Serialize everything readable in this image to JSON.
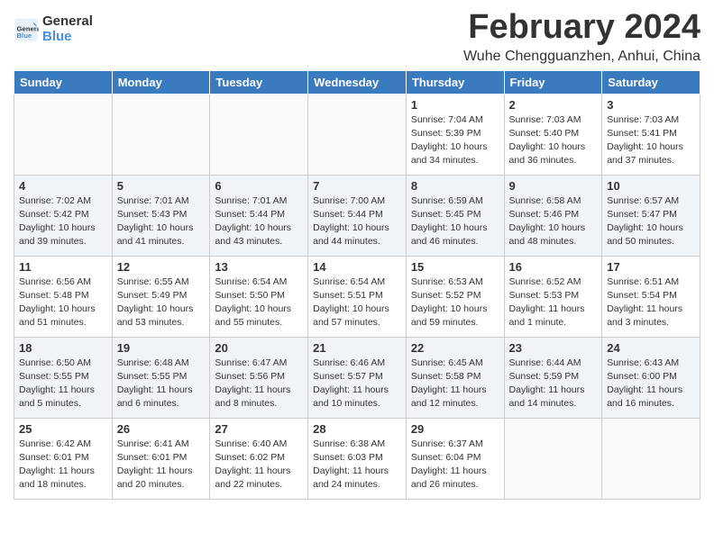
{
  "header": {
    "logo_line1": "General",
    "logo_line2": "Blue",
    "month_year": "February 2024",
    "location": "Wuhe Chengguanzhen, Anhui, China"
  },
  "weekdays": [
    "Sunday",
    "Monday",
    "Tuesday",
    "Wednesday",
    "Thursday",
    "Friday",
    "Saturday"
  ],
  "weeks": [
    [
      {
        "day": "",
        "info": ""
      },
      {
        "day": "",
        "info": ""
      },
      {
        "day": "",
        "info": ""
      },
      {
        "day": "",
        "info": ""
      },
      {
        "day": "1",
        "info": "Sunrise: 7:04 AM\nSunset: 5:39 PM\nDaylight: 10 hours\nand 34 minutes."
      },
      {
        "day": "2",
        "info": "Sunrise: 7:03 AM\nSunset: 5:40 PM\nDaylight: 10 hours\nand 36 minutes."
      },
      {
        "day": "3",
        "info": "Sunrise: 7:03 AM\nSunset: 5:41 PM\nDaylight: 10 hours\nand 37 minutes."
      }
    ],
    [
      {
        "day": "4",
        "info": "Sunrise: 7:02 AM\nSunset: 5:42 PM\nDaylight: 10 hours\nand 39 minutes."
      },
      {
        "day": "5",
        "info": "Sunrise: 7:01 AM\nSunset: 5:43 PM\nDaylight: 10 hours\nand 41 minutes."
      },
      {
        "day": "6",
        "info": "Sunrise: 7:01 AM\nSunset: 5:44 PM\nDaylight: 10 hours\nand 43 minutes."
      },
      {
        "day": "7",
        "info": "Sunrise: 7:00 AM\nSunset: 5:44 PM\nDaylight: 10 hours\nand 44 minutes."
      },
      {
        "day": "8",
        "info": "Sunrise: 6:59 AM\nSunset: 5:45 PM\nDaylight: 10 hours\nand 46 minutes."
      },
      {
        "day": "9",
        "info": "Sunrise: 6:58 AM\nSunset: 5:46 PM\nDaylight: 10 hours\nand 48 minutes."
      },
      {
        "day": "10",
        "info": "Sunrise: 6:57 AM\nSunset: 5:47 PM\nDaylight: 10 hours\nand 50 minutes."
      }
    ],
    [
      {
        "day": "11",
        "info": "Sunrise: 6:56 AM\nSunset: 5:48 PM\nDaylight: 10 hours\nand 51 minutes."
      },
      {
        "day": "12",
        "info": "Sunrise: 6:55 AM\nSunset: 5:49 PM\nDaylight: 10 hours\nand 53 minutes."
      },
      {
        "day": "13",
        "info": "Sunrise: 6:54 AM\nSunset: 5:50 PM\nDaylight: 10 hours\nand 55 minutes."
      },
      {
        "day": "14",
        "info": "Sunrise: 6:54 AM\nSunset: 5:51 PM\nDaylight: 10 hours\nand 57 minutes."
      },
      {
        "day": "15",
        "info": "Sunrise: 6:53 AM\nSunset: 5:52 PM\nDaylight: 10 hours\nand 59 minutes."
      },
      {
        "day": "16",
        "info": "Sunrise: 6:52 AM\nSunset: 5:53 PM\nDaylight: 11 hours\nand 1 minute."
      },
      {
        "day": "17",
        "info": "Sunrise: 6:51 AM\nSunset: 5:54 PM\nDaylight: 11 hours\nand 3 minutes."
      }
    ],
    [
      {
        "day": "18",
        "info": "Sunrise: 6:50 AM\nSunset: 5:55 PM\nDaylight: 11 hours\nand 5 minutes."
      },
      {
        "day": "19",
        "info": "Sunrise: 6:48 AM\nSunset: 5:55 PM\nDaylight: 11 hours\nand 6 minutes."
      },
      {
        "day": "20",
        "info": "Sunrise: 6:47 AM\nSunset: 5:56 PM\nDaylight: 11 hours\nand 8 minutes."
      },
      {
        "day": "21",
        "info": "Sunrise: 6:46 AM\nSunset: 5:57 PM\nDaylight: 11 hours\nand 10 minutes."
      },
      {
        "day": "22",
        "info": "Sunrise: 6:45 AM\nSunset: 5:58 PM\nDaylight: 11 hours\nand 12 minutes."
      },
      {
        "day": "23",
        "info": "Sunrise: 6:44 AM\nSunset: 5:59 PM\nDaylight: 11 hours\nand 14 minutes."
      },
      {
        "day": "24",
        "info": "Sunrise: 6:43 AM\nSunset: 6:00 PM\nDaylight: 11 hours\nand 16 minutes."
      }
    ],
    [
      {
        "day": "25",
        "info": "Sunrise: 6:42 AM\nSunset: 6:01 PM\nDaylight: 11 hours\nand 18 minutes."
      },
      {
        "day": "26",
        "info": "Sunrise: 6:41 AM\nSunset: 6:01 PM\nDaylight: 11 hours\nand 20 minutes."
      },
      {
        "day": "27",
        "info": "Sunrise: 6:40 AM\nSunset: 6:02 PM\nDaylight: 11 hours\nand 22 minutes."
      },
      {
        "day": "28",
        "info": "Sunrise: 6:38 AM\nSunset: 6:03 PM\nDaylight: 11 hours\nand 24 minutes."
      },
      {
        "day": "29",
        "info": "Sunrise: 6:37 AM\nSunset: 6:04 PM\nDaylight: 11 hours\nand 26 minutes."
      },
      {
        "day": "",
        "info": ""
      },
      {
        "day": "",
        "info": ""
      }
    ]
  ]
}
